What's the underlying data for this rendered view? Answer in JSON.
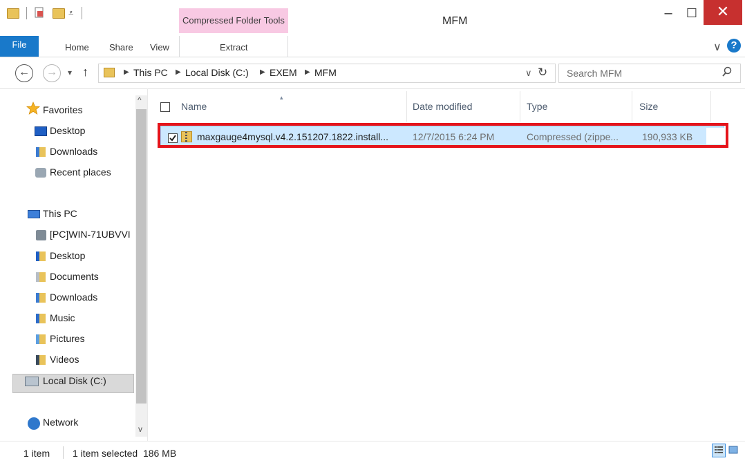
{
  "window": {
    "title": "MFM",
    "context_tab": "Compressed Folder Tools",
    "minimize_glyph": "–",
    "maximize_glyph": "☐",
    "close_glyph": "✕"
  },
  "ribbon": {
    "tabs": [
      "File",
      "Home",
      "Share",
      "View",
      "Extract"
    ],
    "expand_glyph": "∨",
    "help_glyph": "?"
  },
  "address": {
    "back_glyph": "←",
    "forward_glyph": "→",
    "recent_glyph": "▾",
    "up_glyph": "↑",
    "breadcrumb": [
      "This PC",
      "Local Disk (C:)",
      "EXEM",
      "MFM"
    ],
    "dropdown_glyph": "∨",
    "refresh_glyph": "↻",
    "search_placeholder": "Search MFM"
  },
  "nav": {
    "favorites": {
      "label": "Favorites",
      "items": [
        "Desktop",
        "Downloads",
        "Recent places"
      ]
    },
    "this_pc": {
      "label": "This PC",
      "items": [
        "[PC]WIN-71UBVVI",
        "Desktop",
        "Documents",
        "Downloads",
        "Music",
        "Pictures",
        "Videos",
        "Local Disk (C:)"
      ]
    },
    "network": {
      "label": "Network"
    },
    "scroll_up_glyph": "^",
    "scroll_down_glyph": "v"
  },
  "columns": {
    "name": "Name",
    "date": "Date modified",
    "type": "Type",
    "size": "Size"
  },
  "files": [
    {
      "name": "maxgauge4mysql.v4.2.151207.1822.install...",
      "date": "12/7/2015 6:24 PM",
      "type": "Compressed (zippe...",
      "size": "190,933 KB",
      "selected": true
    }
  ],
  "status": {
    "count": "1 item",
    "selection": "1 item selected  186 MB"
  },
  "colors": {
    "file_tab": "#1979ca",
    "context_tab": "#f8c9e3",
    "close_button": "#c7302f",
    "selection": "#cce8ff",
    "highlight_outline": "#e5141b"
  },
  "icons": {
    "qat": [
      "folder-icon",
      "properties-icon",
      "new-folder-icon",
      "customize-qat-icon"
    ],
    "favorites": "star-icon",
    "this_pc": "computer-icon",
    "network": "network-icon",
    "zip": "zip-folder-icon"
  }
}
